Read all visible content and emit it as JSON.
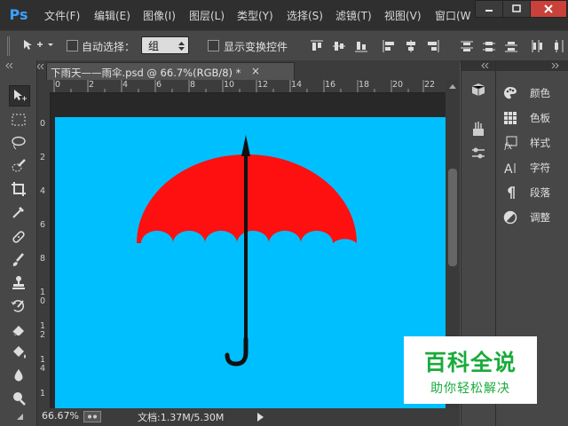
{
  "app": {
    "logo": "Ps"
  },
  "menubar": {
    "items": [
      "文件(F)",
      "编辑(E)",
      "图像(I)",
      "图层(L)",
      "类型(Y)",
      "选择(S)",
      "滤镜(T)",
      "视图(V)",
      "窗口(W"
    ]
  },
  "options_bar": {
    "auto_select_label": "自动选择：",
    "auto_select_value": "组",
    "show_transform_label": "显示变换控件"
  },
  "document": {
    "tab_title": "下雨天——雨伞.psd @ 66.7%(RGB/8) *",
    "tab_close": "×",
    "canvas_color": "#00bfff",
    "umbrella_canopy_color": "#ff1010"
  },
  "rulers": {
    "top_ticks": [
      "0",
      "2",
      "4",
      "6",
      "8",
      "10",
      "12",
      "14",
      "16",
      "18",
      "20",
      "22"
    ],
    "left_ticks": [
      "0",
      "2",
      "4",
      "6",
      "8",
      "1",
      "0",
      "1",
      "2",
      "1",
      "4",
      "1"
    ]
  },
  "status_bar": {
    "zoom": "66.67%",
    "doc_size": "文档:1.37M/5.30M"
  },
  "panels": {
    "items": [
      {
        "label": "颜色",
        "icon": "palette-icon"
      },
      {
        "label": "色板",
        "icon": "swatches-grid-icon"
      },
      {
        "label": "样式",
        "icon": "fx-style-icon"
      },
      {
        "label": "字符",
        "icon": "character-icon"
      },
      {
        "label": "段落",
        "icon": "paragraph-icon"
      },
      {
        "label": "调整",
        "icon": "adjustment-circle-icon"
      }
    ]
  },
  "watermark": {
    "title": "百科全说",
    "subtitle": "助你轻松解决",
    "color": "#1aab3b"
  }
}
